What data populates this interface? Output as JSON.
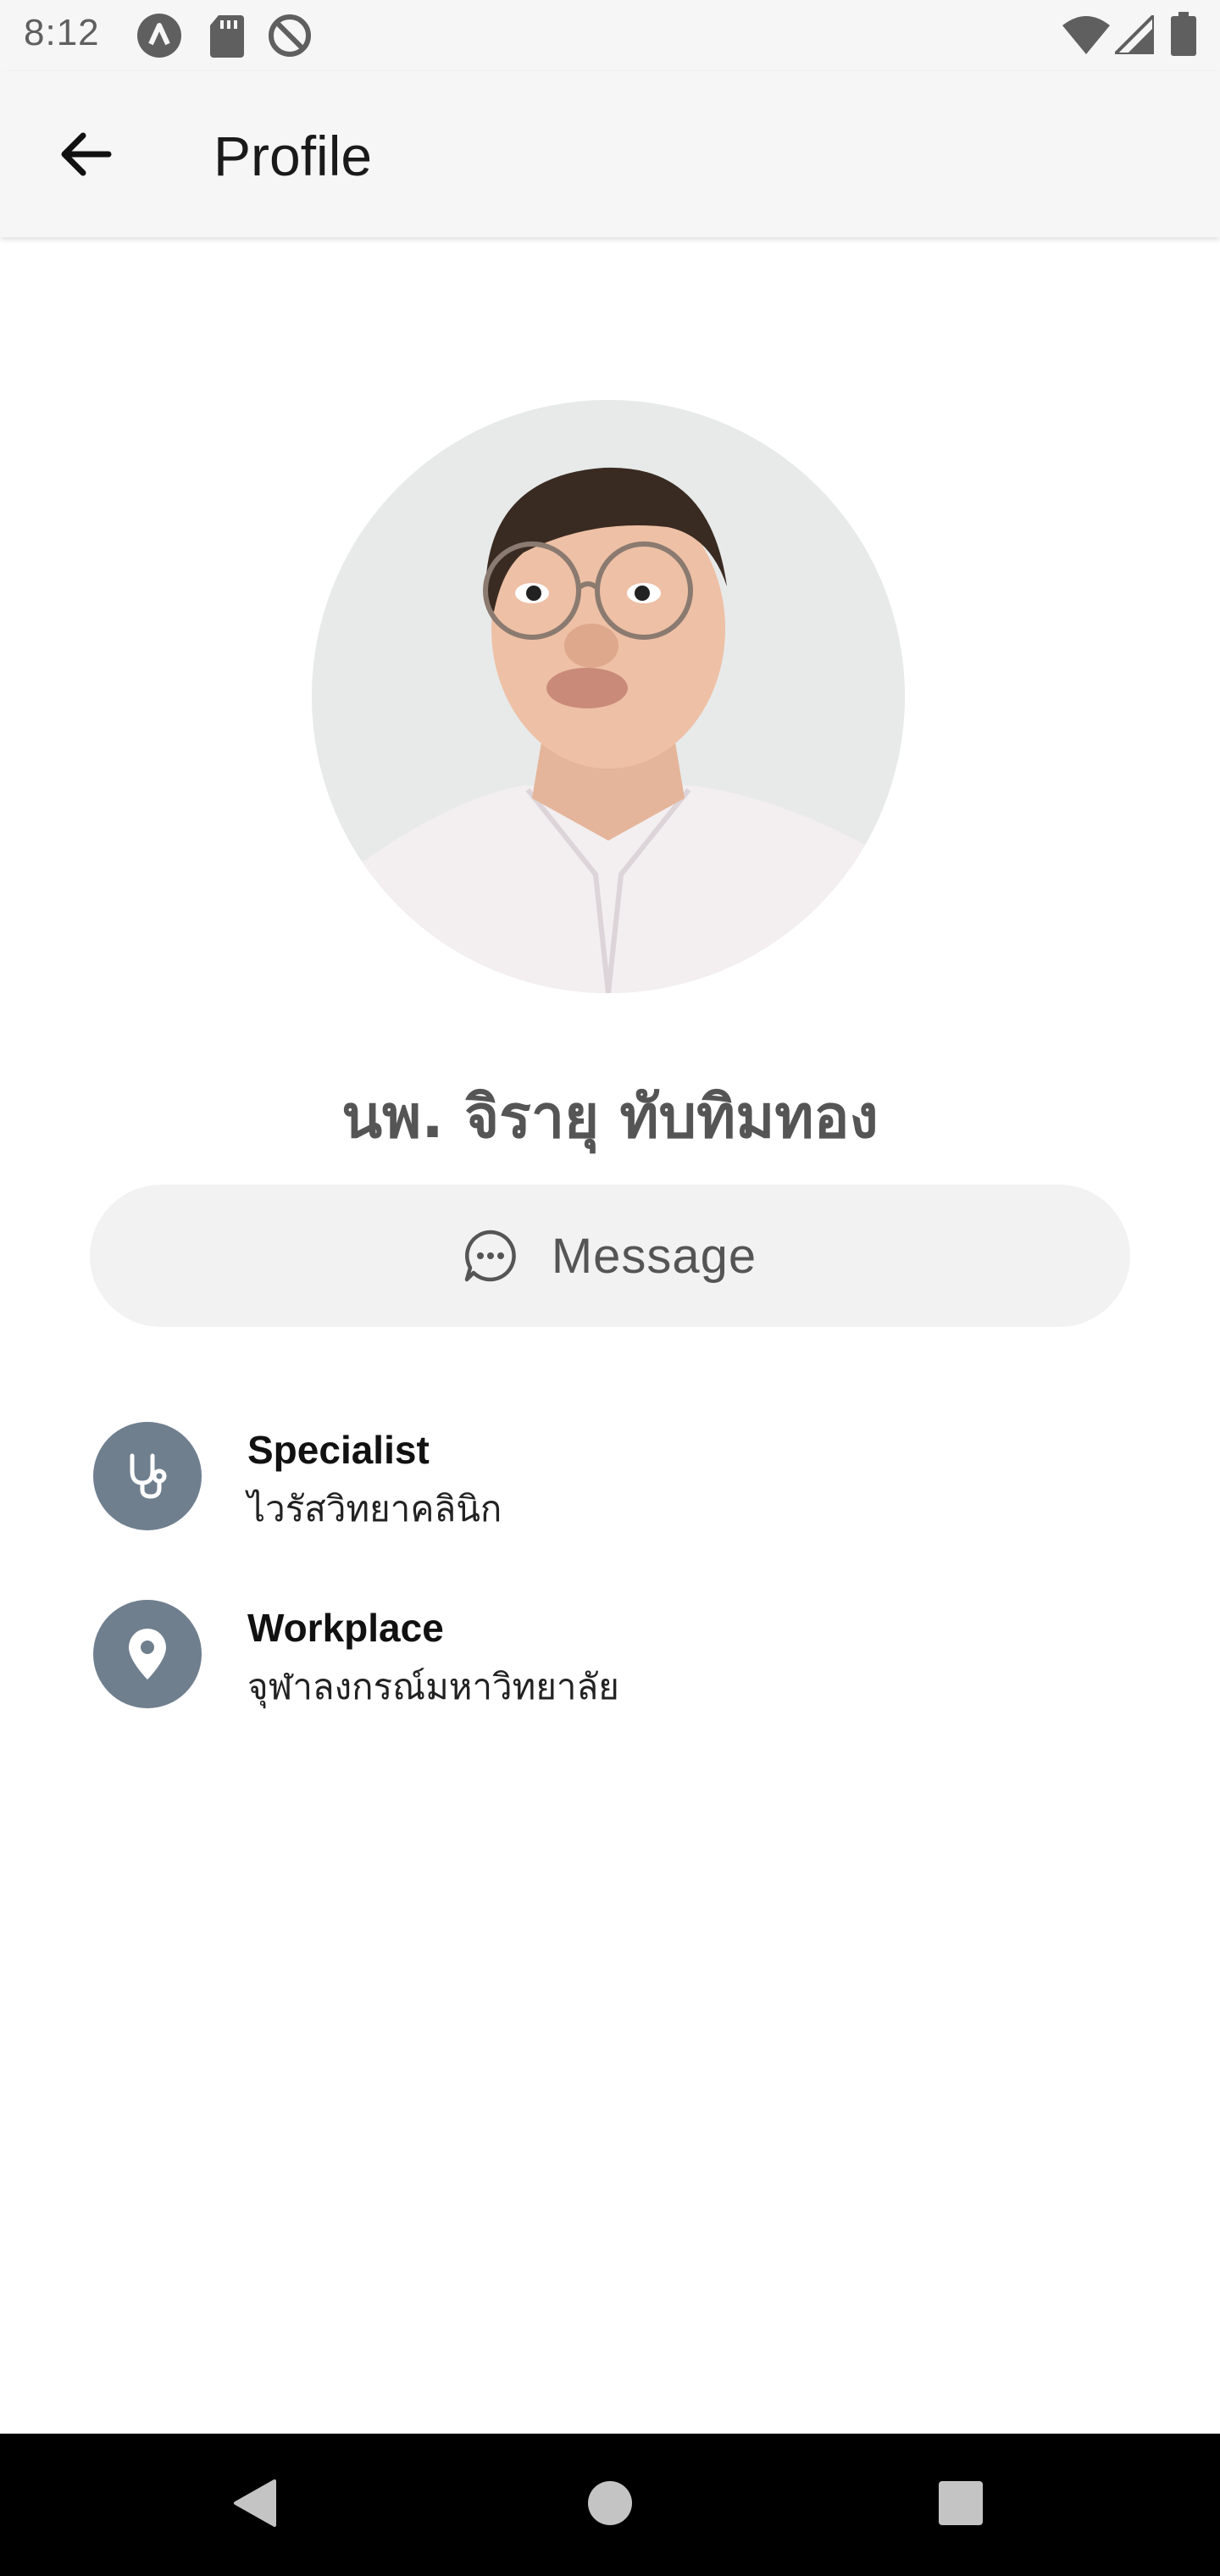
{
  "status_bar": {
    "time": "8:12",
    "left_icons": [
      "app-notification-icon",
      "sd-card-icon",
      "at-sign-icon"
    ],
    "right_icons": [
      "wifi-icon",
      "cell-signal-icon",
      "battery-icon"
    ]
  },
  "app_bar": {
    "back_icon": "arrow-left-icon",
    "title": "Profile"
  },
  "profile": {
    "name": "นพ. จิรายุ ทับทิมทอง",
    "message_label": "Message",
    "message_icon": "chat-bubble-icon"
  },
  "info": [
    {
      "title": "Specialist",
      "value": "ไวรัสวิทยาคลินิก",
      "icon": "stethoscope-icon"
    },
    {
      "title": "Workplace",
      "value": "จุฬาลงกรณ์มหาวิทยาลัย",
      "icon": "location-pin-icon"
    }
  ],
  "nav_bar": {
    "buttons": [
      "back-triangle-icon",
      "home-circle-icon",
      "recents-square-icon"
    ]
  },
  "colors": {
    "app_bar_bg": "#f6f6f6",
    "info_icon_bg": "#6f7f8e",
    "message_button_bg": "#f2f2f2",
    "nav_bar_bg": "#000000"
  }
}
